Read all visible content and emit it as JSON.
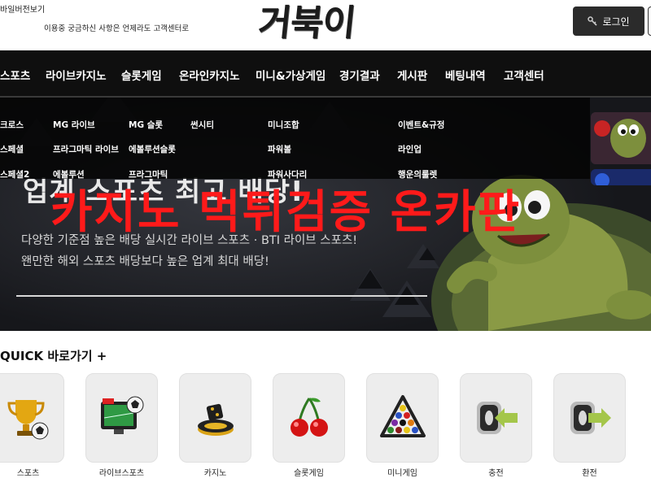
{
  "header": {
    "mobile_link": "바일버전보기",
    "notice": "이용중 궁금하신 사항은 언제라도 고객센터로",
    "logo_text": "거북이",
    "login_label": "로그인"
  },
  "nav": {
    "items": [
      "스포츠",
      "라이브카지노",
      "슬롯게임",
      "온라인카지노",
      "미니&가상게임",
      "경기결과",
      "게시판",
      "베팅내역",
      "고객센터"
    ]
  },
  "dropdown": {
    "col1": [
      "크로스",
      "스페셜",
      "스페셜2"
    ],
    "col2": [
      "MG 라이브",
      "프라그마틱 라이브",
      "에볼루션"
    ],
    "col3": [
      "MG 슬롯",
      "에볼루션슬롯",
      "프라그마틱"
    ],
    "col4": [
      "썬시티"
    ],
    "col5": [
      "미니조합",
      "파워볼",
      "파워사다리"
    ],
    "col6": [
      "이벤트&규정",
      "라인업",
      "행운의룰렛"
    ]
  },
  "hero": {
    "heading": "업계 스포츠 최고 배당!",
    "sub1": "다양한 기준점 높은 배당 실시간 라이브 스포츠 · BTI 라이브 스포츠!",
    "sub2": "왠만한 해외 스포츠 배당보다 높은 업계 최대 배당!",
    "watermark": "카지노 먹튀검증 온카판"
  },
  "quick": {
    "title": "QUICK 바로가기 +",
    "tiles": [
      {
        "label": "스포츠",
        "icon": "trophy-icon"
      },
      {
        "label": "라이브스포츠",
        "icon": "live-tv-icon"
      },
      {
        "label": "카지노",
        "icon": "chips-icon"
      },
      {
        "label": "슬롯게임",
        "icon": "cherry-icon"
      },
      {
        "label": "미니게임",
        "icon": "billiard-rack-icon"
      },
      {
        "label": "충전",
        "icon": "deposit-icon"
      },
      {
        "label": "환전",
        "icon": "withdraw-icon"
      }
    ]
  },
  "colors": {
    "nav_bg": "#0f0f0f",
    "watermark": "#ff1a1a",
    "hero_bg": "#1b1c20",
    "tile_bg": "#ededed"
  }
}
